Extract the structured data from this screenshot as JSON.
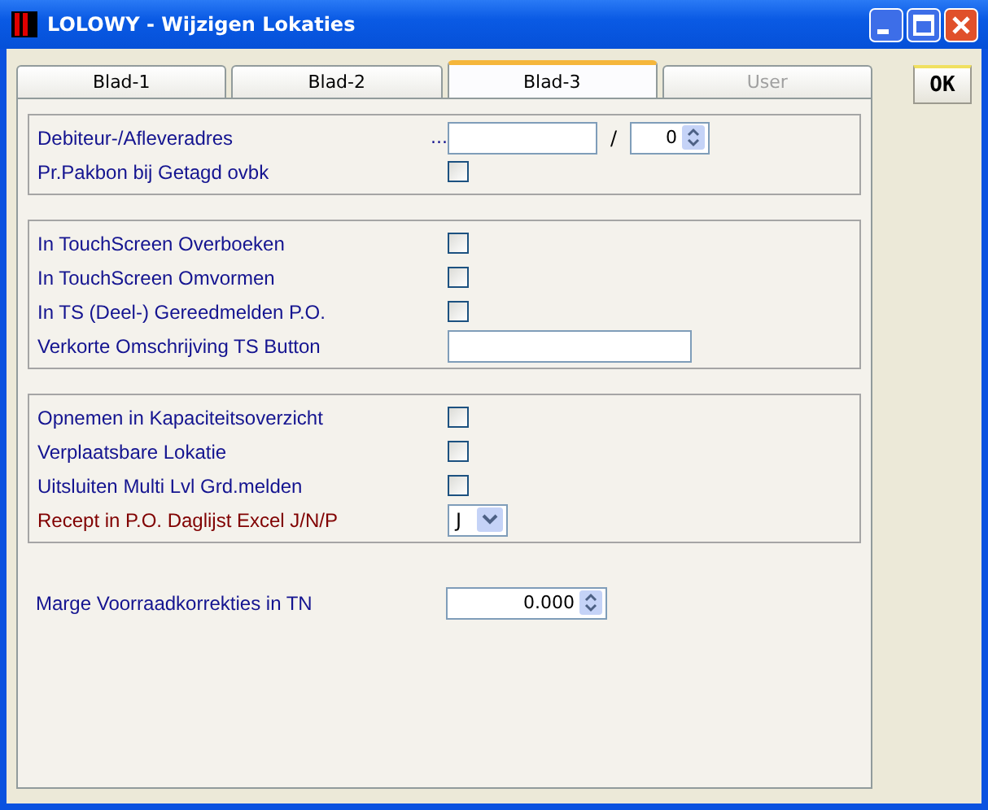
{
  "window": {
    "title": "LOLOWY - Wijzigen Lokaties"
  },
  "tabs": [
    {
      "label": "Blad-1",
      "selected": false,
      "disabled": false
    },
    {
      "label": "Blad-2",
      "selected": false,
      "disabled": false
    },
    {
      "label": "Blad-3",
      "selected": true,
      "disabled": false
    },
    {
      "label": "User",
      "selected": false,
      "disabled": true
    }
  ],
  "ok_button": {
    "label": "OK"
  },
  "groups": [
    {
      "framed": true,
      "rows": [
        {
          "kind": "address",
          "label": "Debiteur-/Afleveradres",
          "emphasis": false,
          "ellipsis": "...",
          "separator": "/",
          "number": "0"
        },
        {
          "kind": "checkbox",
          "label": "Pr.Pakbon bij Getagd ovbk",
          "emphasis": false,
          "checked": false
        }
      ]
    },
    {
      "framed": true,
      "rows": [
        {
          "kind": "checkbox",
          "label": "In TouchScreen Overboeken",
          "emphasis": false,
          "checked": false
        },
        {
          "kind": "checkbox",
          "label": "In TouchScreen Omvormen",
          "emphasis": false,
          "checked": false
        },
        {
          "kind": "checkbox",
          "label": "In TS (Deel-) Gereedmelden P.O.",
          "emphasis": false,
          "checked": false
        },
        {
          "kind": "text",
          "label": "Verkorte Omschrijving TS Button",
          "emphasis": false
        }
      ]
    },
    {
      "framed": true,
      "rows": [
        {
          "kind": "checkbox",
          "label": "Opnemen in Kapaciteitsoverzicht",
          "emphasis": false,
          "checked": false
        },
        {
          "kind": "checkbox",
          "label": "Verplaatsbare Lokatie",
          "emphasis": false,
          "checked": false
        },
        {
          "kind": "checkbox",
          "label": "Uitsluiten Multi Lvl Grd.melden",
          "emphasis": false,
          "checked": false
        },
        {
          "kind": "select",
          "label": "Recept in P.O. Daglijst Excel J/N/P",
          "emphasis": true,
          "value": "J"
        }
      ]
    },
    {
      "framed": false,
      "rows": [
        {
          "kind": "spin",
          "label": "Marge Voorraadkorrekties in TN",
          "emphasis": false,
          "value": "0.000"
        }
      ]
    }
  ]
}
